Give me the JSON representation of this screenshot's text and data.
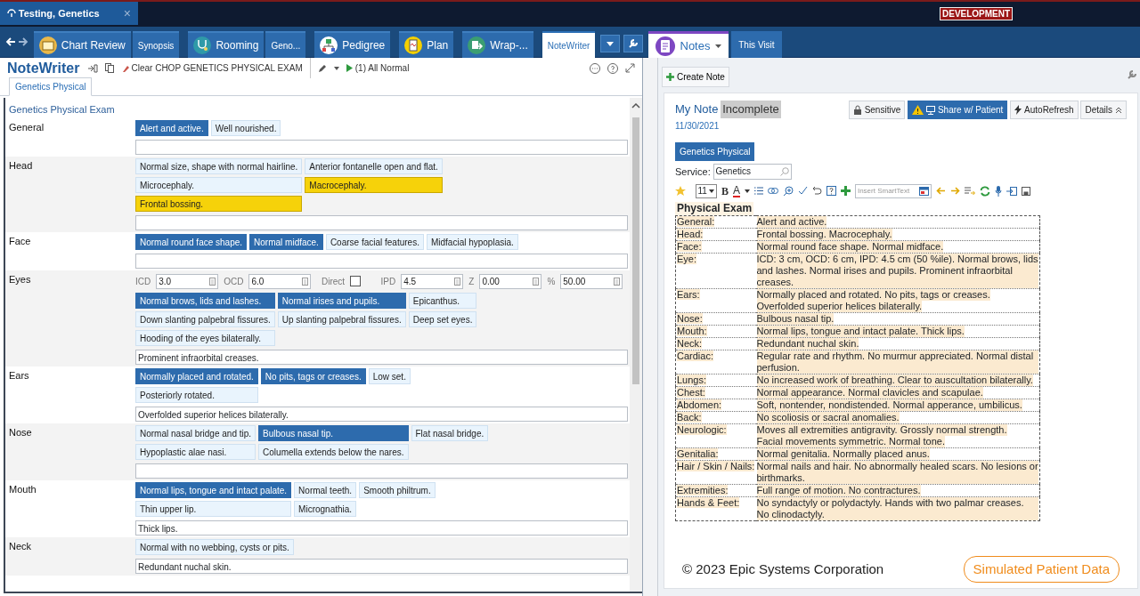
{
  "session_tab": {
    "title": "Testing, Genetics",
    "close": "×"
  },
  "environment_badge": "DEVELOPMENT",
  "activity_tabs": [
    {
      "label": "Chart Review",
      "kind": "folder",
      "selected": false
    },
    {
      "label": "Synopsis",
      "selected": false
    },
    {
      "label": "Rooming",
      "kind": "stethoscope",
      "selected": false
    },
    {
      "label": "Geno...",
      "selected": false
    },
    {
      "label": "Pedigree",
      "kind": "tree",
      "selected": false
    },
    {
      "label": "Plan",
      "kind": "clipboard",
      "selected": false
    },
    {
      "label": "Wrap-...",
      "kind": "exit",
      "selected": false
    },
    {
      "label": "NoteWriter",
      "selected": true
    }
  ],
  "notewriter": {
    "title": "NoteWriter",
    "clear_button": "Clear CHOP GENETICS PHYSICAL EXAM",
    "all_normal_button": "(1) All Normal",
    "tabs": [
      {
        "label": "Genetics Physical",
        "selected": true
      }
    ],
    "section_title": "Genetics Physical Exam",
    "rows": [
      {
        "label": "General",
        "lines": [
          [
            {
              "text": "Alert and active.",
              "selected": true,
              "abnormal": false
            },
            {
              "text": "Well nourished.",
              "selected": false,
              "abnormal": false
            }
          ]
        ]
      },
      {
        "label": "Head",
        "lines": [
          [
            {
              "text": "Normal size, shape with normal hairline.",
              "selected": false,
              "abnormal": false
            },
            {
              "text": "Anterior fontanelle open and flat.",
              "selected": false,
              "abnormal": false
            }
          ],
          [
            {
              "text": "Microcephaly.",
              "selected": false,
              "abnormal": false
            },
            {
              "text": "Macrocephaly.",
              "selected": true,
              "abnormal": true
            }
          ],
          [
            {
              "text": "Frontal bossing.",
              "selected": true,
              "abnormal": true
            }
          ]
        ]
      },
      {
        "label": "Face",
        "lines": [
          [
            {
              "text": "Normal round face shape.",
              "selected": true,
              "abnormal": false
            },
            {
              "text": "Normal midface.",
              "selected": true,
              "abnormal": false
            },
            {
              "text": "Coarse facial features.",
              "selected": false,
              "abnormal": false
            },
            {
              "text": "Midfacial hypoplasia.",
              "selected": false,
              "abnormal": false
            }
          ]
        ]
      },
      {
        "label": "Eyes",
        "measurements": [
          {
            "kind": "number",
            "label": "ICD",
            "value": "3.0"
          },
          {
            "kind": "number",
            "label": "OCD",
            "value": "6.0"
          },
          {
            "kind": "checkbox",
            "label": "Direct",
            "checked": false
          },
          {
            "kind": "number",
            "label": "IPD",
            "value": "4.5"
          },
          {
            "kind": "number",
            "label": "Z",
            "value": "0.00"
          },
          {
            "kind": "number",
            "label": "%",
            "value": "50.00"
          }
        ],
        "lines": [
          [
            {
              "text": "Normal brows, lids and lashes.",
              "selected": true,
              "abnormal": false
            },
            {
              "text": "Normal irises and pupils.",
              "selected": true,
              "abnormal": false
            },
            {
              "text": "Epicanthus.",
              "selected": false,
              "abnormal": false
            }
          ],
          [
            {
              "text": "Down slanting palpebral fissures.",
              "selected": false,
              "abnormal": false
            },
            {
              "text": "Up slanting palpebral fissures.",
              "selected": false,
              "abnormal": false
            },
            {
              "text": "Deep set eyes.",
              "selected": false,
              "abnormal": false
            }
          ],
          [
            {
              "text": "Hooding of the eyes bilaterally.",
              "selected": false,
              "abnormal": false
            }
          ]
        ],
        "free_text": "Prominent infraorbital creases."
      },
      {
        "label": "Ears",
        "lines": [
          [
            {
              "text": "Normally placed and rotated.",
              "selected": true,
              "abnormal": false
            },
            {
              "text": "No pits, tags or creases.",
              "selected": true,
              "abnormal": false
            },
            {
              "text": "Low set.",
              "selected": false,
              "abnormal": false
            }
          ],
          [
            {
              "text": "Posteriorly rotated.",
              "selected": false,
              "abnormal": false
            }
          ]
        ],
        "free_text": "Overfolded superior helices bilaterally."
      },
      {
        "label": "Nose",
        "lines": [
          [
            {
              "text": "Normal nasal bridge and tip.",
              "selected": false,
              "abnormal": false
            },
            {
              "text": "Bulbous nasal tip.",
              "selected": true,
              "abnormal": false
            },
            {
              "text": "Flat nasal bridge.",
              "selected": false,
              "abnormal": false
            }
          ],
          [
            {
              "text": "Hypoplastic alae nasi.",
              "selected": false,
              "abnormal": false
            },
            {
              "text": "Columella extends below the nares.",
              "selected": false,
              "abnormal": false
            }
          ]
        ]
      },
      {
        "label": "Mouth",
        "lines": [
          [
            {
              "text": "Normal lips, tongue and intact palate.",
              "selected": true,
              "abnormal": false
            },
            {
              "text": "Normal teeth.",
              "selected": false,
              "abnormal": false
            },
            {
              "text": "Smooth philtrum.",
              "selected": false,
              "abnormal": false
            }
          ],
          [
            {
              "text": "Thin upper lip.",
              "selected": false,
              "abnormal": false
            },
            {
              "text": "Micrognathia.",
              "selected": false,
              "abnormal": false
            }
          ]
        ],
        "free_text": "Thick lips."
      },
      {
        "label": "Neck",
        "lines": [
          [
            {
              "text": "Normal with no webbing, cysts or pits.",
              "selected": false,
              "abnormal": false
            }
          ]
        ],
        "free_text": "Redundant nuchal skin."
      }
    ]
  },
  "side_tabs": [
    {
      "label": "Notes",
      "selected": true
    },
    {
      "label": "This Visit",
      "selected": false
    }
  ],
  "create_note": "Create Note",
  "note": {
    "title": "My Note",
    "status": "Incomplete",
    "date": "11/30/2021",
    "buttons": [
      {
        "kind": "lock",
        "label": "Sensitive",
        "active": false
      },
      {
        "kind": "share",
        "label": "Share w/ Patient",
        "active": true
      },
      {
        "kind": "bolt",
        "label": "AutoRefresh",
        "active": false
      },
      {
        "kind": "details",
        "label": "Details",
        "active": false
      }
    ],
    "type_button": "Genetics Physical",
    "service_label": "Service:",
    "service_value": "Genetics",
    "font_size": "11",
    "bold": "B",
    "font_color": "A",
    "smarttext_placeholder": "Insert SmartText",
    "heading": "Physical Exam",
    "rows": [
      {
        "label": "General:",
        "text": [
          "Alert and active."
        ]
      },
      {
        "label": "Head:",
        "text": [
          "Frontal bossing. Macrocephaly."
        ]
      },
      {
        "label": "Face:",
        "text": [
          "Normal round face shape. Normal midface."
        ]
      },
      {
        "label": "Eye:",
        "text": [
          "ICD: 3 cm, OCD: 6 cm, IPD: 4.5 cm (50 %ile). Normal brows, lids and lashes. Normal irises and pupils. Prominent infraorbital creases."
        ]
      },
      {
        "label": "Ears:",
        "text": [
          "Normally placed and rotated. No pits, tags or creases.",
          "Overfolded superior helices bilaterally."
        ]
      },
      {
        "label": "Nose:",
        "text": [
          "Bulbous nasal tip."
        ]
      },
      {
        "label": "Mouth:",
        "text": [
          "Normal lips, tongue and intact palate. Thick lips."
        ]
      },
      {
        "label": "Neck:",
        "text": [
          "Redundant nuchal skin."
        ]
      },
      {
        "label": "Cardiac:",
        "text": [
          "Regular rate and rhythm. No murmur appreciated. Normal distal perfusion."
        ]
      },
      {
        "label": "Lungs:",
        "text": [
          "No increased work of breathing. Clear to auscultation bilaterally."
        ]
      },
      {
        "label": "Chest:",
        "text": [
          "Normal appearance. Normal clavicles and scapulae."
        ]
      },
      {
        "label": "Abdomen:",
        "text": [
          "Soft, nontender, nondistended. Normal apperance, umbilicus."
        ]
      },
      {
        "label": "Back:",
        "text": [
          "No scoliosis or sacral anomalies."
        ]
      },
      {
        "label": "Neurologic:",
        "text": [
          "Moves all extremities antigravity. Grossly normal strength.",
          "Facial movements symmetric. Normal tone."
        ]
      },
      {
        "label": "Genitalia:",
        "text": [
          "Normal genitalia. Normally placed anus."
        ]
      },
      {
        "label": "Hair / Skin / Nails:",
        "text": [
          "Normal nails and hair. No abnormally healed scars. No lesions or birthmarks."
        ]
      },
      {
        "label": "Extremities:",
        "text": [
          "Full range of motion. No contractures."
        ]
      },
      {
        "label": "Hands & Feet:",
        "text": [
          "No syndactyly or polydactyly. Hands with two palmar creases. No clinodactyly."
        ]
      }
    ]
  },
  "copyright": "© 2023 Epic Systems Corporation",
  "simulated_badge": "Simulated Patient Data"
}
